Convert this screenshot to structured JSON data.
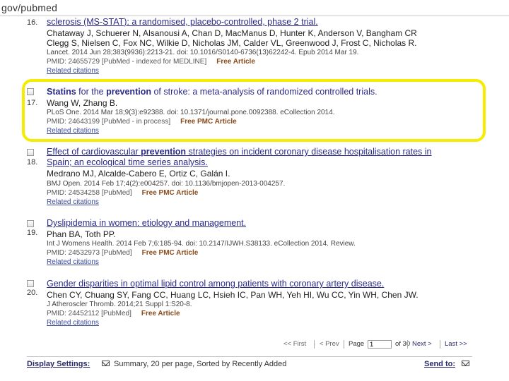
{
  "address_bar": {
    "url": "gov/pubmed"
  },
  "results": [
    {
      "number": "16.",
      "title": "sclerosis (MS-STAT): a randomised, placebo-controlled, phase 2 trial.",
      "authors_line1": "Chataway J, Schuerer N, Alsanousi A, Chan D, MacManus D, Hunter K, Anderson V, Bangham CR",
      "authors_line2": "Clegg S, Nielsen C, Fox NC, Wilkie D, Nicholas JM, Calder VL, Greenwood J, Frost C, Nicholas R.",
      "source": "Lancet. 2014 Jun 28;383(9936):2213-21. doi: 10.1016/S0140-6736(13)62242-4. Epub 2014 Mar 19.",
      "pmid": "PMID: 24655729 [PubMed - indexed for MEDLINE]",
      "free_label": "Free Article",
      "related": "Related citations"
    },
    {
      "number": "17.",
      "title_parts": [
        "Statins",
        " for the ",
        "prevention",
        " of stroke: a meta-analysis of randomized controlled trials."
      ],
      "authors": "Wang W, Zhang B.",
      "source": "PLoS One. 2014 Mar 18;9(3):e92388. doi: 10.1371/journal.pone.0092388. eCollection 2014.",
      "pmid": "PMID: 24643199 [PubMed - in process]",
      "free_label": "Free PMC Article",
      "related": "Related citations"
    },
    {
      "number": "18.",
      "title_line1_parts": [
        "Effect of cardiovascular ",
        "prevention",
        " strategies on incident coronary disease hospitalisation rates in"
      ],
      "title_line2": "Spain; an ecological time series analysis.",
      "authors": "Medrano MJ, Alcalde-Cabero E, Ortiz C, Galán I.",
      "source": "BMJ Open. 2014 Feb 17;4(2):e004257. doi: 10.1136/bmjopen-2013-004257.",
      "pmid": "PMID: 24534258 [PubMed]",
      "free_label": "Free PMC Article",
      "related": "Related citations"
    },
    {
      "number": "19.",
      "title": "Dyslipidemia in women: etiology and management.",
      "authors": "Phan BA, Toth PP.",
      "source": "Int J Womens Health. 2014 Feb 7;6:185-94. doi: 10.2147/IJWH.S38133. eCollection 2014. Review.",
      "pmid": "PMID: 24532973 [PubMed]",
      "free_label": "Free PMC Article",
      "related": "Related citations"
    },
    {
      "number": "20.",
      "title": "Gender disparities in optimal lipid control among patients with coronary artery disease.",
      "authors": "Chen CY, Chuang SY, Fang CC, Huang LC, Hsieh IC, Pan WH, Yeh HI, Wu CC, Yin WH, Chen JW.",
      "source": "J Atheroscler Thromb. 2014;21 Suppl 1:S20-8.",
      "pmid": "PMID: 24452112 [PubMed]",
      "free_label": "Free Article",
      "related": "Related citations"
    }
  ],
  "pagination": {
    "first": "<< First",
    "prev": "< Prev",
    "page_label": "Page",
    "page_value": "1",
    "of_label": "of 30",
    "next": "Next >",
    "last": "Last >>"
  },
  "footer": {
    "display_settings": "Display Settings:",
    "summary": "Summary, 20 per page, Sorted by Recently Added",
    "send_to": "Send to:"
  },
  "colors": {
    "highlight": "#f5ec00",
    "title_link": "#2a2a8a",
    "free_article": "#8a4a1a"
  }
}
